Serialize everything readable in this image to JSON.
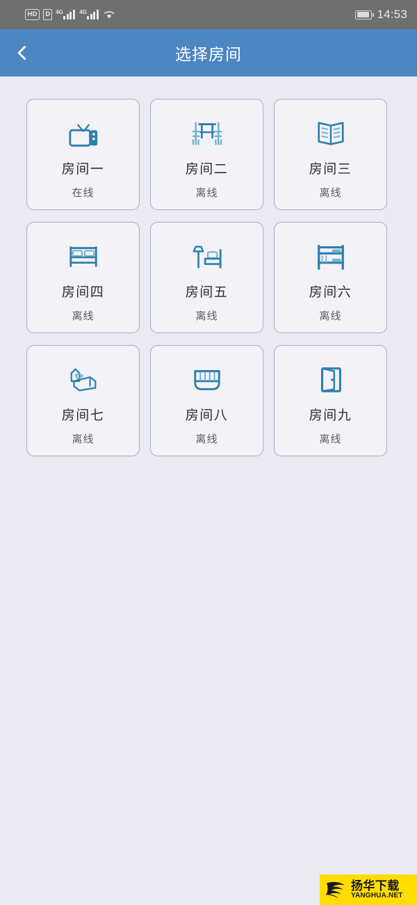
{
  "statusbar": {
    "hd_label": "HD",
    "data_label": "D",
    "sim1_net": "4G",
    "sim2_net": "4G",
    "wifi_icon": "wifi-icon",
    "battery_icon": "battery-icon",
    "time": "14:53"
  },
  "header": {
    "back_icon": "chevron-left-icon",
    "title": "选择房间"
  },
  "rooms": [
    {
      "name": "房间一",
      "status": "在线",
      "icon": "tv-icon"
    },
    {
      "name": "房间二",
      "status": "离线",
      "icon": "table-chairs-icon"
    },
    {
      "name": "房间三",
      "status": "离线",
      "icon": "open-book-icon"
    },
    {
      "name": "房间四",
      "status": "离线",
      "icon": "double-bed-icon"
    },
    {
      "name": "房间五",
      "status": "离线",
      "icon": "lamp-bed-icon"
    },
    {
      "name": "房间六",
      "status": "离线",
      "icon": "bunk-bed-icon"
    },
    {
      "name": "房间七",
      "status": "离线",
      "icon": "single-bed-3d-icon"
    },
    {
      "name": "房间八",
      "status": "离线",
      "icon": "crib-icon"
    },
    {
      "name": "房间九",
      "status": "离线",
      "icon": "door-open-icon"
    }
  ],
  "watermark": {
    "cn": "扬华下载",
    "en": "YANGHUA.NET",
    "bg_color": "#ffdd00"
  },
  "colors": {
    "statusbar_bg": "#6f6f6f",
    "header_bg": "#4c86c3",
    "page_bg": "#eceaf2",
    "card_bg": "#f3f2f7",
    "card_border": "#9fb2c6",
    "icon_blue": "#2f7fae",
    "icon_blue_light": "#6fb3cd"
  }
}
